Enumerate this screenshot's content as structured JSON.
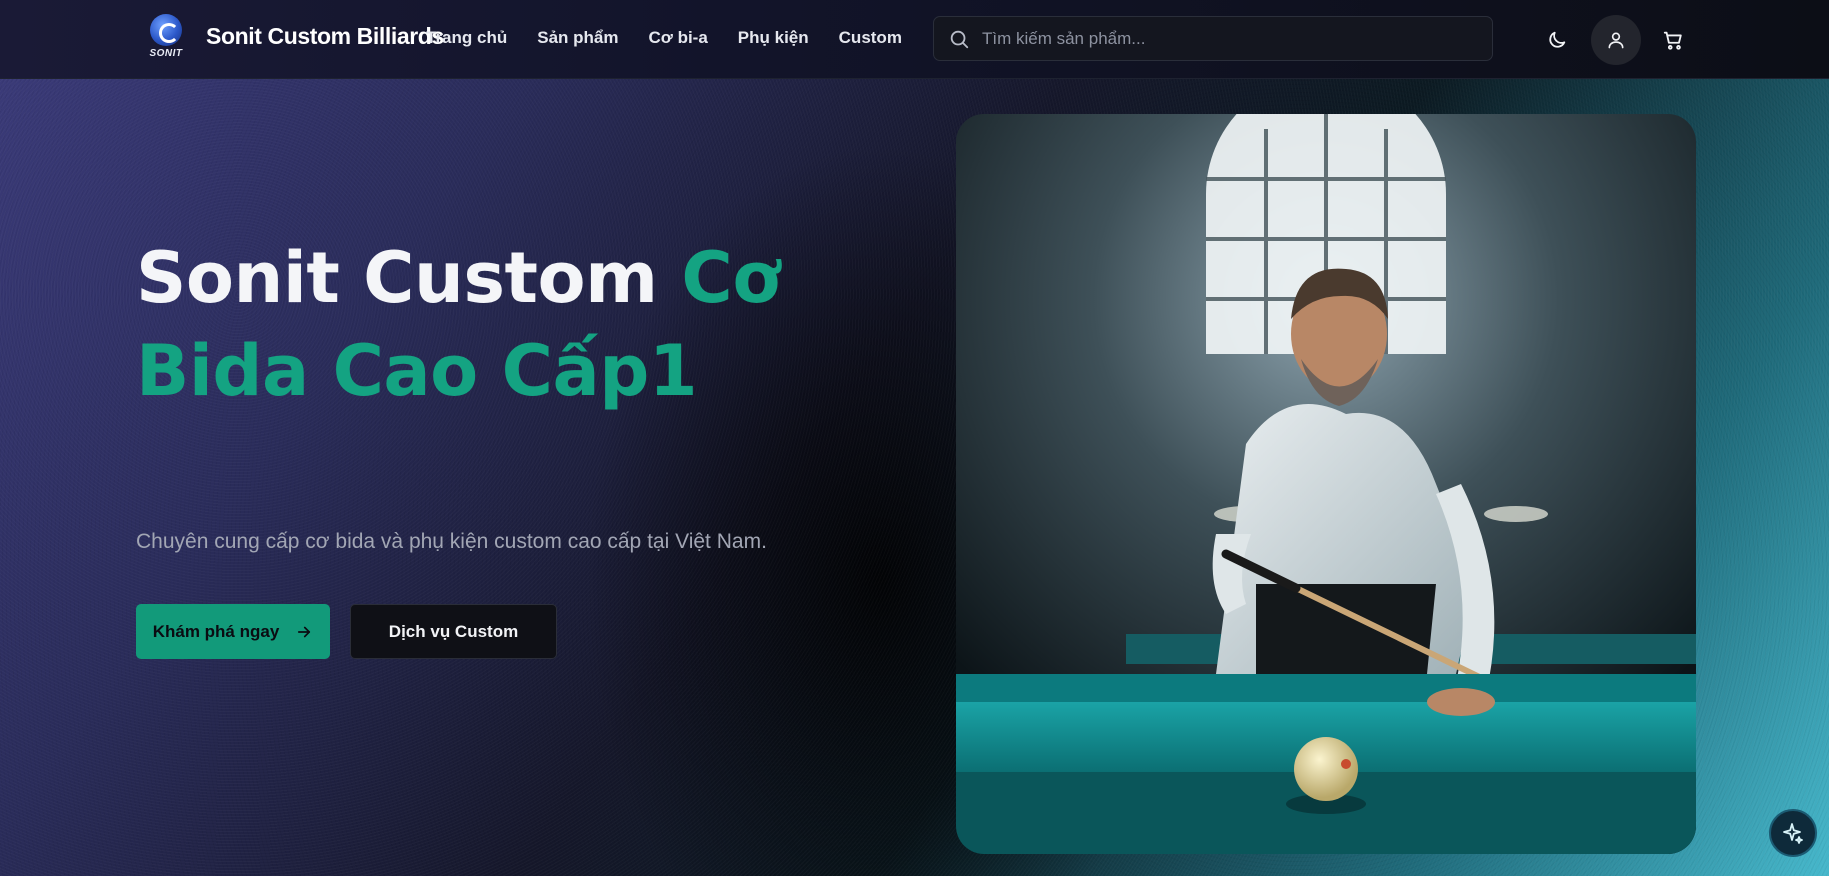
{
  "header": {
    "logo_text": "SONIT",
    "brand": "Sonit Custom Billiards",
    "nav": [
      "Trang chủ",
      "Sản phẩm",
      "Cơ bi-a",
      "Phụ kiện",
      "Custom"
    ],
    "search_placeholder": "Tìm kiếm sản phẩm...",
    "icons": {
      "search": "search-icon",
      "theme": "moon-icon",
      "user": "user-icon",
      "cart": "cart-icon"
    }
  },
  "hero": {
    "title_white": "Sonit Custom ",
    "title_green": "Cơ Bida Cao Cấp1",
    "subtitle": "Chuyên cung cấp cơ bida và phụ kiện custom cao cấp tại Việt Nam.",
    "primary_button": "Khám phá ngay",
    "secondary_button": "Dịch vụ Custom",
    "image": "man-playing-billiards-photo"
  },
  "floating_button": "sparkle-ai-icon",
  "colors": {
    "accent": "#129a7a",
    "accent_text": "#14a382",
    "header_bg": "#12142a"
  }
}
